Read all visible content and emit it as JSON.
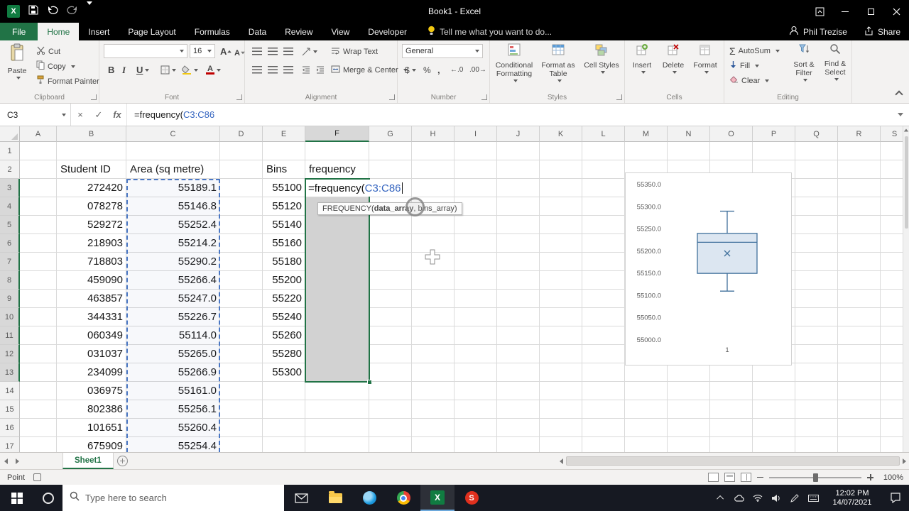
{
  "title_bar": {
    "title": "Book1 - Excel"
  },
  "glyphs": {
    "cancel": "×",
    "enter": "✓",
    "sigma": "Σ",
    "excel_x": "X",
    "snagit_s": "S"
  },
  "ribbon": {
    "tabs": [
      {
        "label": "File"
      },
      {
        "label": "Home"
      },
      {
        "label": "Insert"
      },
      {
        "label": "Page Layout"
      },
      {
        "label": "Formulas"
      },
      {
        "label": "Data"
      },
      {
        "label": "Review"
      },
      {
        "label": "View"
      },
      {
        "label": "Developer"
      }
    ],
    "active_tab": "Home",
    "tell_me": "Tell me what you want to do...",
    "user_name": "Phil Trezise",
    "share_label": "Share",
    "groups": {
      "clipboard": {
        "label": "Clipboard",
        "paste": "Paste",
        "cut": "Cut",
        "copy": "Copy",
        "format_painter": "Format Painter"
      },
      "font": {
        "label": "Font",
        "font_name": "",
        "font_size": "16",
        "bold": "B",
        "italic": "I",
        "underline": "U",
        "grow": "A",
        "shrink": "A",
        "color_letter": "A"
      },
      "alignment": {
        "label": "Alignment",
        "wrap_text": "Wrap Text",
        "merge_center": "Merge & Center"
      },
      "number": {
        "label": "Number",
        "format": "General",
        "currency": "$",
        "percent": "%",
        "comma": ",",
        "inc_decimal": "←.0",
        "dec_decimal": ".00→"
      },
      "styles": {
        "label": "Styles",
        "conditional": "Conditional Formatting",
        "format_table": "Format as Table",
        "cell_styles": "Cell Styles"
      },
      "cells": {
        "label": "Cells",
        "insert": "Insert",
        "delete": "Delete",
        "format": "Format"
      },
      "editing": {
        "label": "Editing",
        "autosum": "AutoSum",
        "fill": "Fill",
        "clear": "Clear",
        "sort": "Sort & Filter",
        "find": "Find & Select"
      }
    }
  },
  "formula_bar": {
    "name_box": "C3",
    "fx": "fx",
    "prefix": "=frequency(",
    "ref": "C3:C86"
  },
  "active_cell": {
    "ref": "F3",
    "prefix": "=frequency(",
    "range": "C3:C86"
  },
  "screentip": {
    "fn": "FREQUENCY(",
    "arg1": "data_array",
    "rest": ", bins_array)"
  },
  "sheet": {
    "columns": [
      "A",
      "B",
      "C",
      "D",
      "E",
      "F",
      "G",
      "H",
      "I",
      "J",
      "K",
      "L",
      "M",
      "N",
      "O",
      "P",
      "Q",
      "R",
      "S"
    ],
    "selected_column": "F",
    "selected_rows": [
      3,
      13
    ],
    "row_count": 17,
    "table": {
      "headers": {
        "B": "Student ID",
        "C": "Area (sq metre)",
        "E": "Bins",
        "F": "frequency"
      },
      "students": [
        {
          "id": "272420",
          "area": "55189.1"
        },
        {
          "id": "078278",
          "area": "55146.8"
        },
        {
          "id": "529272",
          "area": "55252.4"
        },
        {
          "id": "218903",
          "area": "55214.2"
        },
        {
          "id": "718803",
          "area": "55290.2"
        },
        {
          "id": "459090",
          "area": "55266.4"
        },
        {
          "id": "463857",
          "area": "55247.0"
        },
        {
          "id": "344331",
          "area": "55226.7"
        },
        {
          "id": "060349",
          "area": "55114.0"
        },
        {
          "id": "031037",
          "area": "55265.0"
        },
        {
          "id": "234099",
          "area": "55266.9"
        },
        {
          "id": "036975",
          "area": "55161.0"
        },
        {
          "id": "802386",
          "area": "55256.1"
        },
        {
          "id": "101651",
          "area": "55260.4"
        },
        {
          "id": "675909",
          "area": "55254.4"
        }
      ],
      "bins": [
        "55100",
        "55120",
        "55140",
        "55160",
        "55180",
        "55200",
        "55220",
        "55240",
        "55260",
        "55280",
        "55300"
      ]
    }
  },
  "chart_data": {
    "type": "boxplot",
    "title": "",
    "categories": [
      "1"
    ],
    "series": [
      {
        "name": "Area (sq metre)",
        "whisker_low": 55110,
        "q1": 55150,
        "median": 55220,
        "q3": 55240,
        "whisker_high": 55290,
        "mean": 55195
      }
    ],
    "ylim": [
      55000,
      55350
    ],
    "yticks": [
      55350,
      55300,
      55250,
      55200,
      55150,
      55100,
      55050,
      55000
    ],
    "ytick_labels": [
      "55350.0",
      "55300.0",
      "55250.0",
      "55200.0",
      "55150.0",
      "55100.0",
      "55050.0",
      "55000.0"
    ],
    "xlabel": "",
    "ylabel": "",
    "legend": "none",
    "gridlines": false
  },
  "sheet_tabs": {
    "tabs": [
      "Sheet1"
    ],
    "active": "Sheet1"
  },
  "status_bar": {
    "mode": "Point",
    "zoom": "100%"
  },
  "taskbar": {
    "search_placeholder": "Type here to search",
    "clock": {
      "time": "12:02 PM",
      "date": "14/07/2021"
    }
  }
}
